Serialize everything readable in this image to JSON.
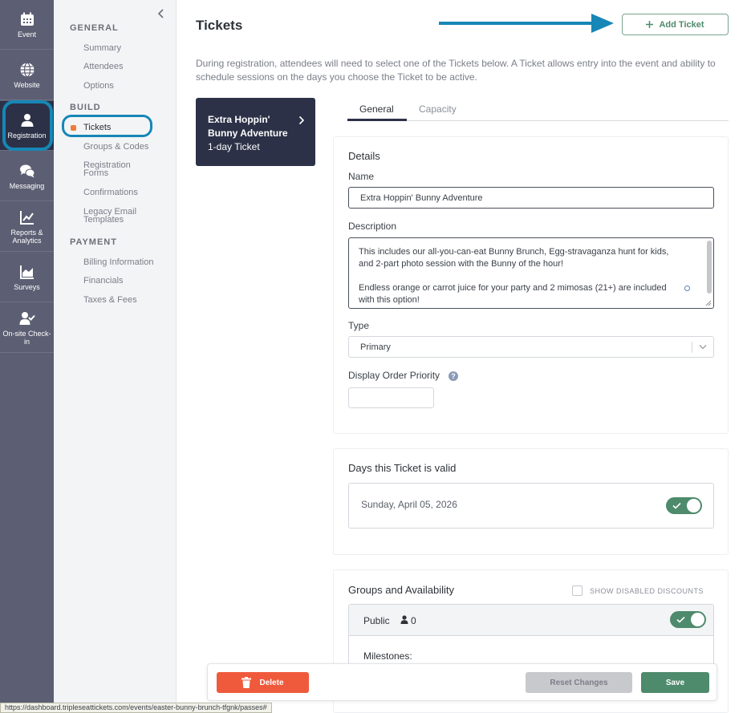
{
  "rail": {
    "items": [
      {
        "label": "Event",
        "icon": "calendar-icon"
      },
      {
        "label": "Website",
        "icon": "globe-icon"
      },
      {
        "label": "Registration",
        "icon": "person-icon",
        "active": true
      },
      {
        "label": "Messaging",
        "icon": "chat-bubbles-icon"
      },
      {
        "label": "Reports & Analytics",
        "icon": "line-chart-icon"
      },
      {
        "label": "Surveys",
        "icon": "survey-chart-icon"
      },
      {
        "label": "On-site Check-in",
        "icon": "person-check-icon"
      }
    ]
  },
  "subnav": {
    "sections": {
      "general": "GENERAL",
      "build": "BUILD",
      "payment": "PAYMENT"
    },
    "general_items": [
      "Summary",
      "Attendees",
      "Options"
    ],
    "build_items": [
      "Tickets",
      "Groups & Codes",
      "Registration Forms",
      "Confirmations",
      "Legacy Email Templates"
    ],
    "payment_items": [
      "Billing Information",
      "Financials",
      "Taxes & Fees"
    ],
    "active_item": "Tickets"
  },
  "main": {
    "title": "Tickets",
    "add_ticket_label": "Add Ticket",
    "intro": "During registration, attendees will need to select one of the Tickets below. A Ticket allows entry into the event and ability to schedule sessions on the days you choose the Ticket to be active.",
    "ticket_card": {
      "name": "Extra Hoppin' Bunny Adventure",
      "sub": "1-day Ticket"
    },
    "tabs": [
      "General",
      "Capacity"
    ],
    "details": {
      "title": "Details",
      "name_label": "Name",
      "name_value": "Extra Hoppin' Bunny Adventure",
      "description_label": "Description",
      "description_p1": "This includes our all-you-can-eat Bunny Brunch, Egg-stravaganza hunt for kids, and 2-part photo session with the Bunny of the hour!",
      "description_p2": "Endless orange or carrot juice for your party and 2 mimosas (21+) are included with this option!",
      "type_label": "Type",
      "type_value": "Primary",
      "order_label": "Display Order Priority",
      "help_glyph": "?"
    },
    "days": {
      "title": "Days this Ticket is valid",
      "day": "Sunday, April 05, 2026",
      "enabled": true
    },
    "groups": {
      "title": "Groups and Availability",
      "show_disabled_label": "SHOW DISABLED DISCOUNTS",
      "group_name": "Public",
      "group_count": "0",
      "milestones_label": "Milestones:",
      "enabled": true
    },
    "actions": {
      "delete": "Delete",
      "reset": "Reset Changes",
      "save": "Save"
    }
  },
  "status_url": "https://dashboard.tripleseattickets.com/events/easter-bunny-brunch-tfgnk/passes#",
  "colors": {
    "rail": "#5c5f73",
    "rail_active": "#2c3147",
    "highlight_ring": "#1687b6",
    "accent_green": "#4e8a6c",
    "delete_red": "#ef5a3c",
    "active_dot": "#f07b3a"
  }
}
